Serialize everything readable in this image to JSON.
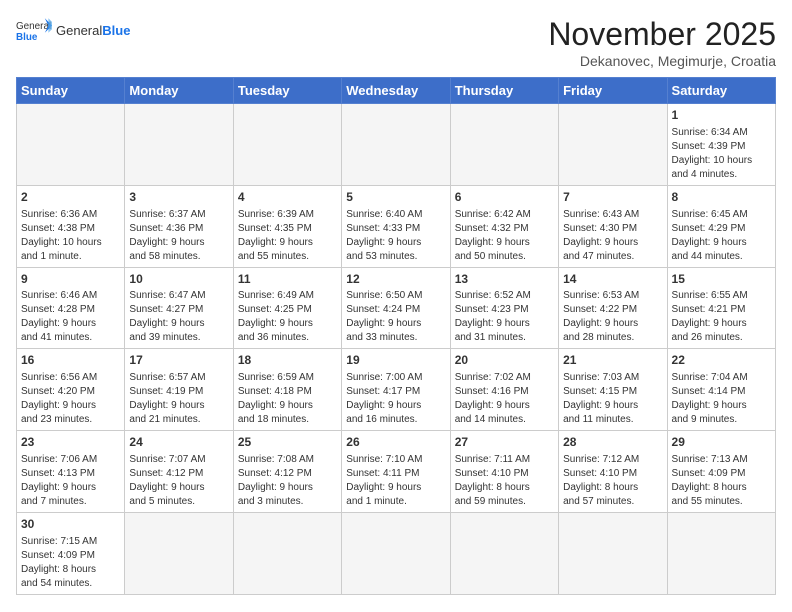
{
  "header": {
    "logo_general": "General",
    "logo_blue": "Blue",
    "month": "November 2025",
    "location": "Dekanovec, Megimurje, Croatia"
  },
  "weekdays": [
    "Sunday",
    "Monday",
    "Tuesday",
    "Wednesday",
    "Thursday",
    "Friday",
    "Saturday"
  ],
  "weeks": [
    [
      {
        "day": "",
        "info": ""
      },
      {
        "day": "",
        "info": ""
      },
      {
        "day": "",
        "info": ""
      },
      {
        "day": "",
        "info": ""
      },
      {
        "day": "",
        "info": ""
      },
      {
        "day": "",
        "info": ""
      },
      {
        "day": "1",
        "info": "Sunrise: 6:34 AM\nSunset: 4:39 PM\nDaylight: 10 hours\nand 4 minutes."
      }
    ],
    [
      {
        "day": "2",
        "info": "Sunrise: 6:36 AM\nSunset: 4:38 PM\nDaylight: 10 hours\nand 1 minute."
      },
      {
        "day": "3",
        "info": "Sunrise: 6:37 AM\nSunset: 4:36 PM\nDaylight: 9 hours\nand 58 minutes."
      },
      {
        "day": "4",
        "info": "Sunrise: 6:39 AM\nSunset: 4:35 PM\nDaylight: 9 hours\nand 55 minutes."
      },
      {
        "day": "5",
        "info": "Sunrise: 6:40 AM\nSunset: 4:33 PM\nDaylight: 9 hours\nand 53 minutes."
      },
      {
        "day": "6",
        "info": "Sunrise: 6:42 AM\nSunset: 4:32 PM\nDaylight: 9 hours\nand 50 minutes."
      },
      {
        "day": "7",
        "info": "Sunrise: 6:43 AM\nSunset: 4:30 PM\nDaylight: 9 hours\nand 47 minutes."
      },
      {
        "day": "8",
        "info": "Sunrise: 6:45 AM\nSunset: 4:29 PM\nDaylight: 9 hours\nand 44 minutes."
      }
    ],
    [
      {
        "day": "9",
        "info": "Sunrise: 6:46 AM\nSunset: 4:28 PM\nDaylight: 9 hours\nand 41 minutes."
      },
      {
        "day": "10",
        "info": "Sunrise: 6:47 AM\nSunset: 4:27 PM\nDaylight: 9 hours\nand 39 minutes."
      },
      {
        "day": "11",
        "info": "Sunrise: 6:49 AM\nSunset: 4:25 PM\nDaylight: 9 hours\nand 36 minutes."
      },
      {
        "day": "12",
        "info": "Sunrise: 6:50 AM\nSunset: 4:24 PM\nDaylight: 9 hours\nand 33 minutes."
      },
      {
        "day": "13",
        "info": "Sunrise: 6:52 AM\nSunset: 4:23 PM\nDaylight: 9 hours\nand 31 minutes."
      },
      {
        "day": "14",
        "info": "Sunrise: 6:53 AM\nSunset: 4:22 PM\nDaylight: 9 hours\nand 28 minutes."
      },
      {
        "day": "15",
        "info": "Sunrise: 6:55 AM\nSunset: 4:21 PM\nDaylight: 9 hours\nand 26 minutes."
      }
    ],
    [
      {
        "day": "16",
        "info": "Sunrise: 6:56 AM\nSunset: 4:20 PM\nDaylight: 9 hours\nand 23 minutes."
      },
      {
        "day": "17",
        "info": "Sunrise: 6:57 AM\nSunset: 4:19 PM\nDaylight: 9 hours\nand 21 minutes."
      },
      {
        "day": "18",
        "info": "Sunrise: 6:59 AM\nSunset: 4:18 PM\nDaylight: 9 hours\nand 18 minutes."
      },
      {
        "day": "19",
        "info": "Sunrise: 7:00 AM\nSunset: 4:17 PM\nDaylight: 9 hours\nand 16 minutes."
      },
      {
        "day": "20",
        "info": "Sunrise: 7:02 AM\nSunset: 4:16 PM\nDaylight: 9 hours\nand 14 minutes."
      },
      {
        "day": "21",
        "info": "Sunrise: 7:03 AM\nSunset: 4:15 PM\nDaylight: 9 hours\nand 11 minutes."
      },
      {
        "day": "22",
        "info": "Sunrise: 7:04 AM\nSunset: 4:14 PM\nDaylight: 9 hours\nand 9 minutes."
      }
    ],
    [
      {
        "day": "23",
        "info": "Sunrise: 7:06 AM\nSunset: 4:13 PM\nDaylight: 9 hours\nand 7 minutes."
      },
      {
        "day": "24",
        "info": "Sunrise: 7:07 AM\nSunset: 4:12 PM\nDaylight: 9 hours\nand 5 minutes."
      },
      {
        "day": "25",
        "info": "Sunrise: 7:08 AM\nSunset: 4:12 PM\nDaylight: 9 hours\nand 3 minutes."
      },
      {
        "day": "26",
        "info": "Sunrise: 7:10 AM\nSunset: 4:11 PM\nDaylight: 9 hours\nand 1 minute."
      },
      {
        "day": "27",
        "info": "Sunrise: 7:11 AM\nSunset: 4:10 PM\nDaylight: 8 hours\nand 59 minutes."
      },
      {
        "day": "28",
        "info": "Sunrise: 7:12 AM\nSunset: 4:10 PM\nDaylight: 8 hours\nand 57 minutes."
      },
      {
        "day": "29",
        "info": "Sunrise: 7:13 AM\nSunset: 4:09 PM\nDaylight: 8 hours\nand 55 minutes."
      }
    ],
    [
      {
        "day": "30",
        "info": "Sunrise: 7:15 AM\nSunset: 4:09 PM\nDaylight: 8 hours\nand 54 minutes."
      },
      {
        "day": "",
        "info": ""
      },
      {
        "day": "",
        "info": ""
      },
      {
        "day": "",
        "info": ""
      },
      {
        "day": "",
        "info": ""
      },
      {
        "day": "",
        "info": ""
      },
      {
        "day": "",
        "info": ""
      }
    ]
  ]
}
